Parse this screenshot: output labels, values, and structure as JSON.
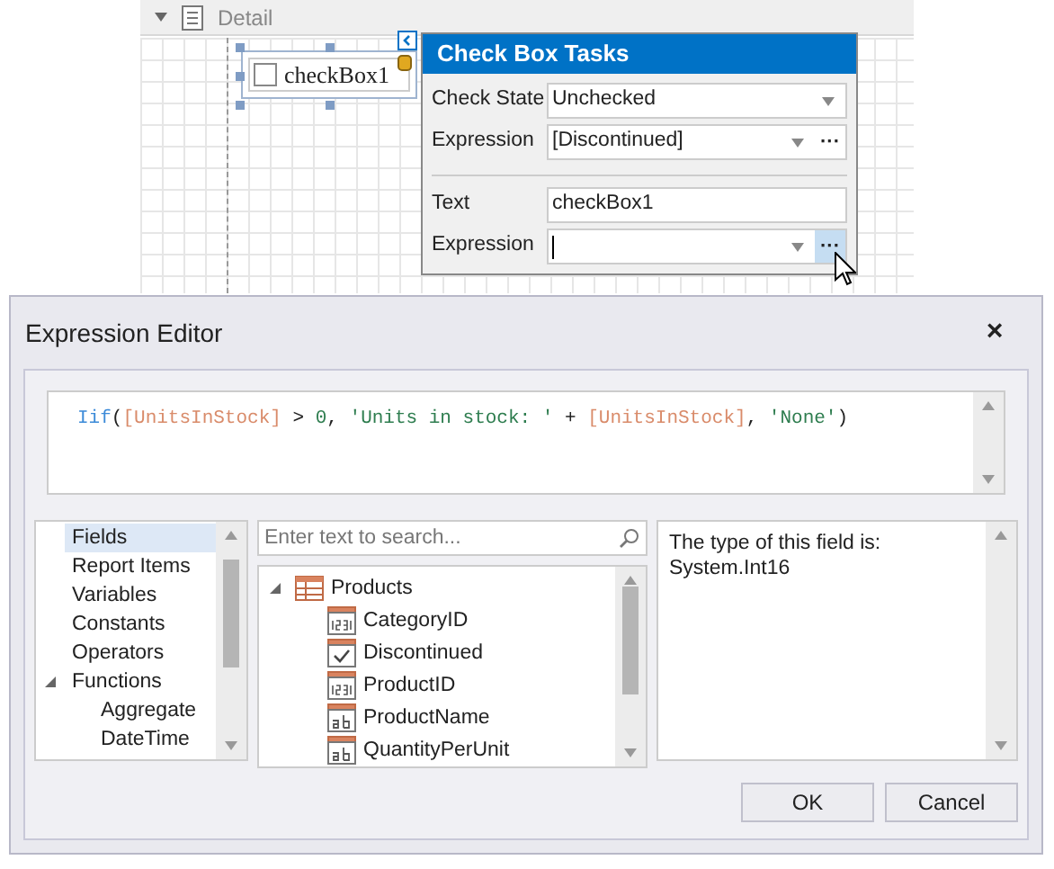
{
  "band": {
    "title": "Detail",
    "expanded": true
  },
  "control": {
    "label": "checkBox1",
    "checked": false
  },
  "tasks": {
    "title": "Check Box Tasks",
    "rows": [
      {
        "label": "Check State",
        "value": "Unchecked",
        "kind": "dropdown"
      },
      {
        "label": "Expression",
        "value": "[Discontinued]",
        "kind": "expression",
        "ellipsis": "···",
        "hovered": false
      },
      {
        "label": "Text",
        "value": "checkBox1",
        "kind": "text"
      },
      {
        "label": "Expression",
        "value": "",
        "kind": "expression",
        "ellipsis": "···",
        "hovered": true
      }
    ]
  },
  "dialog": {
    "title": "Expression Editor",
    "close": "×",
    "expression": [
      {
        "kind": "function",
        "text": "Iif"
      },
      {
        "kind": "plain",
        "text": "("
      },
      {
        "kind": "field",
        "text": "[UnitsInStock]"
      },
      {
        "kind": "plain",
        "text": " > "
      },
      {
        "kind": "number",
        "text": "0"
      },
      {
        "kind": "plain",
        "text": ", "
      },
      {
        "kind": "string",
        "text": "'Units in stock: '"
      },
      {
        "kind": "plain",
        "text": " + "
      },
      {
        "kind": "field",
        "text": "[UnitsInStock]"
      },
      {
        "kind": "plain",
        "text": ", "
      },
      {
        "kind": "string",
        "text": "'None'"
      },
      {
        "kind": "plain",
        "text": ")"
      }
    ],
    "categories": [
      {
        "label": "Fields",
        "selected": true
      },
      {
        "label": "Report Items",
        "selected": false
      },
      {
        "label": "Variables",
        "selected": false
      },
      {
        "label": "Constants",
        "selected": false
      },
      {
        "label": "Operators",
        "selected": false
      },
      {
        "label": "Functions",
        "selected": false,
        "expanded": true,
        "children": [
          {
            "label": "Aggregate",
            "selected": false
          },
          {
            "label": "DateTime",
            "selected": false
          }
        ]
      }
    ],
    "search": {
      "placeholder": "Enter text to search..."
    },
    "tree": [
      {
        "label": "Products",
        "kind": "table",
        "expanded": true,
        "children": [
          {
            "label": "CategoryID",
            "kind": "number"
          },
          {
            "label": "Discontinued",
            "kind": "boolean"
          },
          {
            "label": "ProductID",
            "kind": "number"
          },
          {
            "label": "ProductName",
            "kind": "string"
          },
          {
            "label": "QuantityPerUnit",
            "kind": "string"
          }
        ]
      }
    ],
    "description": "The type of this field is:\nSystem.Int16",
    "buttons": [
      "OK",
      "Cancel"
    ]
  }
}
